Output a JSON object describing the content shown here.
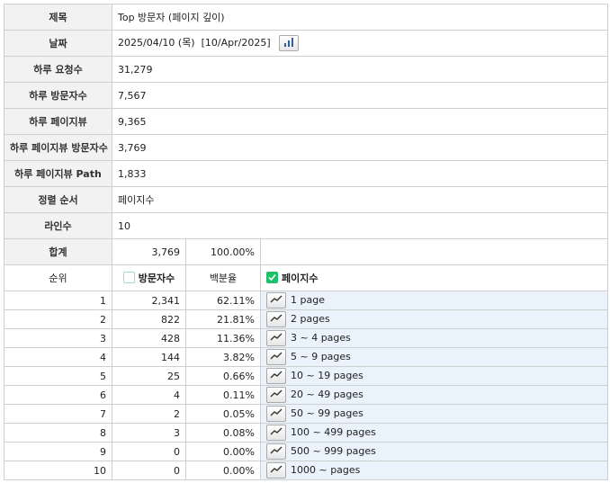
{
  "info": [
    {
      "label": "제목",
      "value": "Top 방문자 (페이지 깊이)"
    },
    {
      "label": "날짜",
      "value": "2025/04/10 (목)  [10/Apr/2025]"
    },
    {
      "label": "하루 요청수",
      "value": "31,279"
    },
    {
      "label": "하루 방문자수",
      "value": "7,567"
    },
    {
      "label": "하루 페이지뷰",
      "value": "9,365"
    },
    {
      "label": "하루 페이지뷰 방문자수",
      "value": "3,769"
    },
    {
      "label": "하루 페이지뷰 Path",
      "value": "1,833"
    },
    {
      "label": "정렬 순서",
      "value": "페이지수"
    },
    {
      "label": "라인수",
      "value": "10"
    }
  ],
  "summary": {
    "label": "합계",
    "visitors": "3,769",
    "percent": "100.00%"
  },
  "header": {
    "rank": "순위",
    "visitors": "방문자수",
    "percent": "백분율",
    "pages": "페이지수"
  },
  "rows": [
    {
      "rank": "1",
      "visitors": "2,341",
      "percent": "62.11%",
      "pages": "1 page"
    },
    {
      "rank": "2",
      "visitors": "822",
      "percent": "21.81%",
      "pages": "2 pages"
    },
    {
      "rank": "3",
      "visitors": "428",
      "percent": "11.36%",
      "pages": "3 ~ 4 pages"
    },
    {
      "rank": "4",
      "visitors": "144",
      "percent": "3.82%",
      "pages": "5 ~ 9 pages"
    },
    {
      "rank": "5",
      "visitors": "25",
      "percent": "0.66%",
      "pages": "10 ~ 19 pages"
    },
    {
      "rank": "6",
      "visitors": "4",
      "percent": "0.11%",
      "pages": "20 ~ 49 pages"
    },
    {
      "rank": "7",
      "visitors": "2",
      "percent": "0.05%",
      "pages": "50 ~ 99 pages"
    },
    {
      "rank": "8",
      "visitors": "3",
      "percent": "0.08%",
      "pages": "100 ~ 499 pages"
    },
    {
      "rank": "9",
      "visitors": "0",
      "percent": "0.00%",
      "pages": "500 ~ 999 pages"
    },
    {
      "rank": "10",
      "visitors": "0",
      "percent": "0.00%",
      "pages": "1000 ~ pages"
    }
  ],
  "icons": {
    "date_chart": "bar-chart-icon",
    "row_trend": "trend-line-icon"
  },
  "colors": {
    "label_bg": "#f2f2f2",
    "pages_bg": "#eaf2fb",
    "check_green": "#1fbf6b"
  }
}
